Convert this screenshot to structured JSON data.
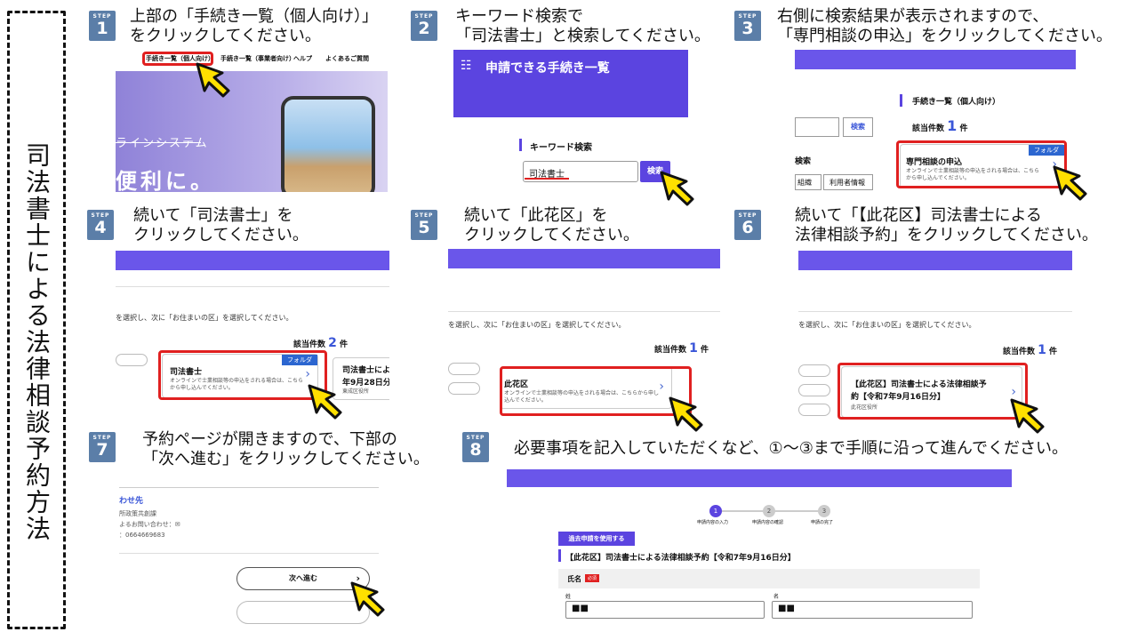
{
  "title": "司法書士による法律相談予約方法",
  "step_label": "STEP",
  "steps": [
    {
      "num": "1",
      "text": "上部の「手続き一覧（個人向け）」\nをクリックしてください。"
    },
    {
      "num": "2",
      "text": "キーワード検索で\n「司法書士」と検索してください。"
    },
    {
      "num": "3",
      "text": "右側に検索結果が表示されますので、\n「専門相談の申込」をクリックしてください。"
    },
    {
      "num": "4",
      "text": "続いて「司法書士」を\nクリックしてください。"
    },
    {
      "num": "5",
      "text": "続いて「此花区」を\nクリックしてください。"
    },
    {
      "num": "6",
      "text": "続いて「【此花区】司法書士による\n法律相談予約」をクリックしてください。"
    },
    {
      "num": "7",
      "text": "予約ページが開きますので、下部の\n「次へ進む」をクリックしてください。"
    },
    {
      "num": "8",
      "text": "必要事項を記入していただくなど、①～③まで手順に沿って進んでください。"
    }
  ],
  "shot1": {
    "nav": [
      "手続き一覧（個人向け）",
      "手続き一覧（事業者向け）",
      "ヘルプ",
      "よくあるご質問"
    ],
    "hero1": "ラインシステム",
    "hero2": "便利に。"
  },
  "shot2": {
    "header": "申請できる手続き一覧",
    "section": "キーワード検索",
    "input_value": "司法書士",
    "search_button": "検索"
  },
  "shot3": {
    "section": "手続き一覧（個人向け）",
    "count_label": "該当件数",
    "count": "1",
    "count_unit": "件",
    "search_button": "検索",
    "left_label": "検索",
    "tab1": "組織",
    "tab2": "利用者情報",
    "folder": "フォルダ",
    "card_title": "専門相談の申込",
    "card_desc": "オンラインで士業相談等の申込をされる場合は、こちらから申し込んでください。"
  },
  "shot4": {
    "instruction": "を選択し、次に「お住まいの区」を選択してください。",
    "count_label": "該当件数",
    "count": "2",
    "count_unit": "件",
    "folder": "フォルダ",
    "card_title": "司法書士",
    "card_desc": "オンラインで士業相談等の申込をされる場合は、こちらから申し込んでください。",
    "card2_title": "司法書士によ",
    "card2_date": "年9月28日分】",
    "card2_office": "東成区役所"
  },
  "shot5": {
    "instruction": "を選択し、次に「お住まいの区」を選択してください。",
    "count_label": "該当件数",
    "count": "1",
    "count_unit": "件",
    "card_title": "此花区",
    "card_desc": "オンラインで士業相談等の申込をされる場合は、こちらから申し込んでください。"
  },
  "shot6": {
    "instruction": "を選択し、次に「お住まいの区」を選択してください。",
    "count_label": "該当件数",
    "count": "1",
    "count_unit": "件",
    "card_title1": "【此花区】司法書士による法律相談予",
    "card_title2": "約【令和7年9月16日分】",
    "card_office": "此花区役所"
  },
  "shot7": {
    "contact_title": "わせ先",
    "line1": "所政策共創課",
    "line2": "よるお問い合わせ：✉",
    "line3": "：0664669683",
    "next_button": "次へ進む"
  },
  "shot8": {
    "progress_steps": [
      {
        "num": "1",
        "label": "申請内容の入力"
      },
      {
        "num": "2",
        "label": "申請内容の確認"
      },
      {
        "num": "3",
        "label": "申請の完了"
      }
    ],
    "past_button": "過去申請を使用する",
    "form_title": "【此花区】司法書士による法律相談予約【令和7年9月16日分】",
    "name_label": "氏名",
    "required": "必須",
    "sei_label": "姓",
    "mei_label": "名",
    "sei_value": "■■",
    "mei_value": "■■"
  },
  "colors": {
    "accent": "#5b44e0",
    "step_badge": "#5b7ea8",
    "highlight": "#e02020",
    "pointer": "#ffe000"
  }
}
